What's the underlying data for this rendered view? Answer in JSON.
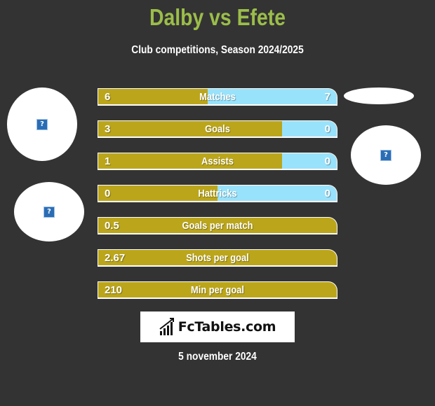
{
  "header": {
    "title": "Dalby vs Efete",
    "subtitle": "Club competitions, Season 2024/2025"
  },
  "teams": {
    "left": {
      "name": "Dalby",
      "logo_icon": "image-placeholder-icon"
    },
    "right": {
      "name": "Efete",
      "logo_icon": "image-placeholder-icon"
    }
  },
  "colors": {
    "title": "#9bbd4a",
    "left_bar": "#bba61b",
    "right_bar": "#99e2fb",
    "background": "#333333"
  },
  "stats": [
    {
      "label": "Matches",
      "left": "6",
      "right": "7",
      "right_share": 0.54
    },
    {
      "label": "Goals",
      "left": "3",
      "right": "0",
      "right_share": 0.23
    },
    {
      "label": "Assists",
      "left": "1",
      "right": "0",
      "right_share": 0.23
    },
    {
      "label": "Hattricks",
      "left": "0",
      "right": "0",
      "right_share": 0.5
    },
    {
      "label": "Goals per match",
      "left": "0.5",
      "right": "",
      "right_share": 0
    },
    {
      "label": "Shots per goal",
      "left": "2.67",
      "right": "",
      "right_share": 0
    },
    {
      "label": "Min per goal",
      "left": "210",
      "right": "",
      "right_share": 0
    }
  ],
  "footer": {
    "brand": "FcTables.com",
    "date": "5 november 2024"
  }
}
